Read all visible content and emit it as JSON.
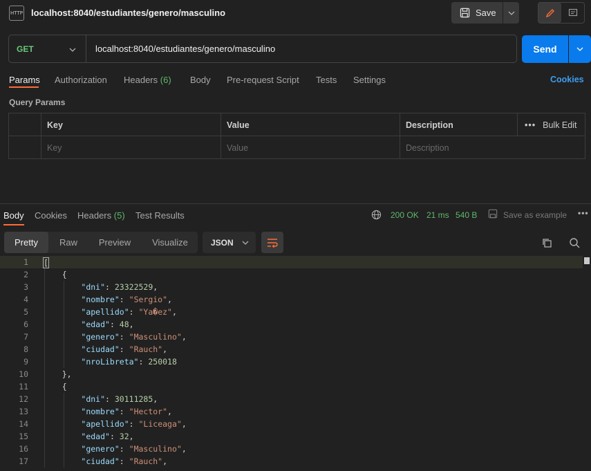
{
  "title": {
    "request_name": "localhost:8040/estudiantes/genero/masculino",
    "save_label": "Save"
  },
  "request": {
    "method": "GET",
    "url": "localhost:8040/estudiantes/genero/masculino",
    "send_label": "Send"
  },
  "request_tabs": {
    "params": "Params",
    "authorization": "Authorization",
    "headers": "Headers",
    "headers_count": "(6)",
    "body": "Body",
    "pre_request": "Pre-request Script",
    "tests": "Tests",
    "settings": "Settings",
    "cookies": "Cookies"
  },
  "query_params": {
    "label": "Query Params",
    "columns": [
      "Key",
      "Value",
      "Description"
    ],
    "bulk_edit": "Bulk Edit",
    "placeholders": [
      "Key",
      "Value",
      "Description"
    ]
  },
  "response_tabs": {
    "body": "Body",
    "cookies": "Cookies",
    "headers": "Headers",
    "headers_count": "(5)",
    "test_results": "Test Results"
  },
  "response_meta": {
    "status": "200 OK",
    "time": "21 ms",
    "size": "540 B",
    "save_example": "Save as example"
  },
  "format": {
    "modes": [
      "Pretty",
      "Raw",
      "Preview",
      "Visualize"
    ],
    "active_mode": "Pretty",
    "language": "JSON"
  },
  "code_lines": [
    {
      "n": "1",
      "text": "["
    },
    {
      "n": "2",
      "text": "    {"
    },
    {
      "n": "3",
      "key": "dni",
      "num": "23322529"
    },
    {
      "n": "4",
      "key": "nombre",
      "str": "Sergio"
    },
    {
      "n": "5",
      "key": "apellido",
      "str": "Ya�ez"
    },
    {
      "n": "6",
      "key": "edad",
      "num": "48"
    },
    {
      "n": "7",
      "key": "genero",
      "str": "Masculino"
    },
    {
      "n": "8",
      "key": "ciudad",
      "str": "Rauch"
    },
    {
      "n": "9",
      "key": "nroLibreta",
      "num": "250018",
      "last": true
    },
    {
      "n": "10",
      "text": "    },"
    },
    {
      "n": "11",
      "text": "    {"
    },
    {
      "n": "12",
      "key": "dni",
      "num": "30111285"
    },
    {
      "n": "13",
      "key": "nombre",
      "str": "Hector"
    },
    {
      "n": "14",
      "key": "apellido",
      "str": "Liceaga"
    },
    {
      "n": "15",
      "key": "edad",
      "num": "32"
    },
    {
      "n": "16",
      "key": "genero",
      "str": "Masculino"
    },
    {
      "n": "17",
      "key": "ciudad",
      "str": "Rauch"
    }
  ]
}
